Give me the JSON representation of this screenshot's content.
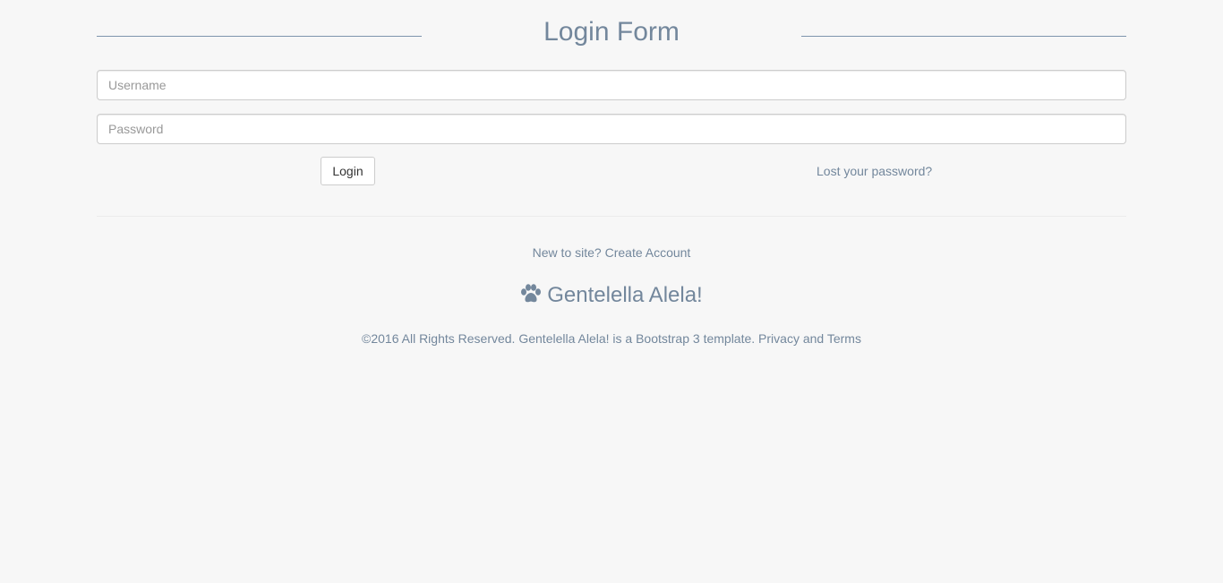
{
  "form": {
    "title": "Login Form",
    "username_placeholder": "Username",
    "username_value": "",
    "password_placeholder": "Password",
    "password_value": "",
    "login_label": "Login",
    "lost_password_label": "Lost your password?"
  },
  "signup": {
    "prompt": "New to site?",
    "create_account_label": "Create Account"
  },
  "brand": {
    "icon": "paw-icon",
    "name": "Gentelella Alela!"
  },
  "footer": {
    "copyright": "©2016 All Rights Reserved. Gentelella Alela! is a Bootstrap 3 template. Privacy and Terms"
  },
  "colors": {
    "text": "#73879c",
    "background": "#f7f7f7",
    "border": "#cccccc"
  }
}
